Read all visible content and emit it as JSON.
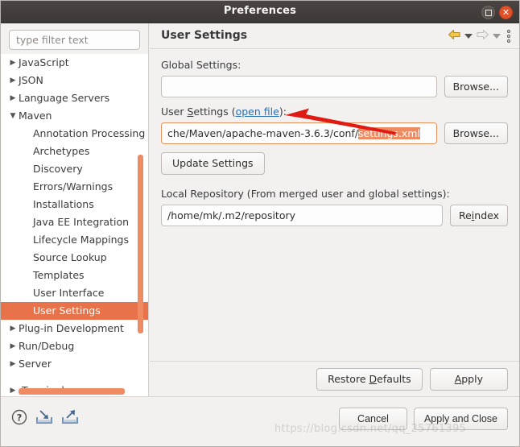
{
  "window": {
    "title": "Preferences",
    "maximize_label": "Restore",
    "close_label": "Close"
  },
  "sidebar": {
    "filter": {
      "placeholder": "type filter text",
      "value": ""
    },
    "items": [
      {
        "label": "JavaScript",
        "level": 0,
        "state": "collapsed",
        "selected": false
      },
      {
        "label": "JSON",
        "level": 0,
        "state": "collapsed",
        "selected": false
      },
      {
        "label": "Language Servers",
        "level": 0,
        "state": "collapsed",
        "selected": false
      },
      {
        "label": "Maven",
        "level": 0,
        "state": "expanded",
        "selected": false
      },
      {
        "label": "Annotation Processing",
        "level": 1,
        "state": "leaf",
        "selected": false
      },
      {
        "label": "Archetypes",
        "level": 1,
        "state": "leaf",
        "selected": false
      },
      {
        "label": "Discovery",
        "level": 1,
        "state": "leaf",
        "selected": false
      },
      {
        "label": "Errors/Warnings",
        "level": 1,
        "state": "leaf",
        "selected": false
      },
      {
        "label": "Installations",
        "level": 1,
        "state": "leaf",
        "selected": false
      },
      {
        "label": "Java EE Integration",
        "level": 1,
        "state": "leaf",
        "selected": false
      },
      {
        "label": "Lifecycle Mappings",
        "level": 1,
        "state": "leaf",
        "selected": false
      },
      {
        "label": "Source Lookup",
        "level": 1,
        "state": "leaf",
        "selected": false
      },
      {
        "label": "Templates",
        "level": 1,
        "state": "leaf",
        "selected": false
      },
      {
        "label": "User Interface",
        "level": 1,
        "state": "leaf",
        "selected": false
      },
      {
        "label": "User Settings",
        "level": 1,
        "state": "leaf",
        "selected": true
      },
      {
        "label": "Plug-in Development",
        "level": 0,
        "state": "collapsed",
        "selected": false
      },
      {
        "label": "Run/Debug",
        "level": 0,
        "state": "collapsed",
        "selected": false
      },
      {
        "label": "Server",
        "level": 0,
        "state": "collapsed",
        "selected": false
      }
    ],
    "clipped_item": {
      "label": "Terminal",
      "state": "collapsed"
    }
  },
  "page": {
    "title": "User Settings",
    "nav": {
      "back_icon": "back-arrow-icon",
      "back_dropdown_icon": "chevron-down-icon",
      "forward_icon": "forward-arrow-icon",
      "forward_dropdown_icon": "chevron-down-icon",
      "menu_icon": "kebab-menu-icon"
    },
    "global_settings": {
      "label": "Global Settings:",
      "label_mnemonic": "S",
      "value": "",
      "browse_label": "Browse..."
    },
    "user_settings": {
      "label_prefix": "User ",
      "label_mnemonic": "S",
      "label_mid": "ettings (",
      "link_label": "open file",
      "label_suffix": "):",
      "value_plain": "che/Maven/apache-maven-3.6.3/conf/",
      "value_selected": "settings.xml",
      "browse_label": "Browse...",
      "update_label": "Update Settings",
      "focused": true
    },
    "local_repository": {
      "label": "Local Repository (From merged user and global settings):",
      "value": "/home/mk/.m2/repository",
      "reindex_label_prefix": "Re",
      "reindex_label_mnemonic": "i",
      "reindex_label_suffix": "ndex"
    },
    "restore_defaults_prefix": "Restore ",
    "restore_defaults_mnemonic": "D",
    "restore_defaults_suffix": "efaults",
    "apply_prefix": "",
    "apply_mnemonic": "A",
    "apply_suffix": "pply"
  },
  "footer": {
    "help_icon": "help-question-icon",
    "import_icon": "import-icon",
    "export_icon": "export-icon",
    "cancel_label": "Cancel",
    "apply_close_label": "Apply and Close"
  },
  "annotation": {
    "arrow_icon": "red-pointer-arrow",
    "arrow_color": "#e01b14"
  },
  "watermark": {
    "text": "https://blog.csdn.net/qq_25761395"
  },
  "colors": {
    "selection_orange": "#e8734a",
    "scrollbar_orange": "#ef8b62",
    "link_blue": "#2a6fb5",
    "titlebar_dark": "#3c3836",
    "close_red": "#e0502a"
  }
}
